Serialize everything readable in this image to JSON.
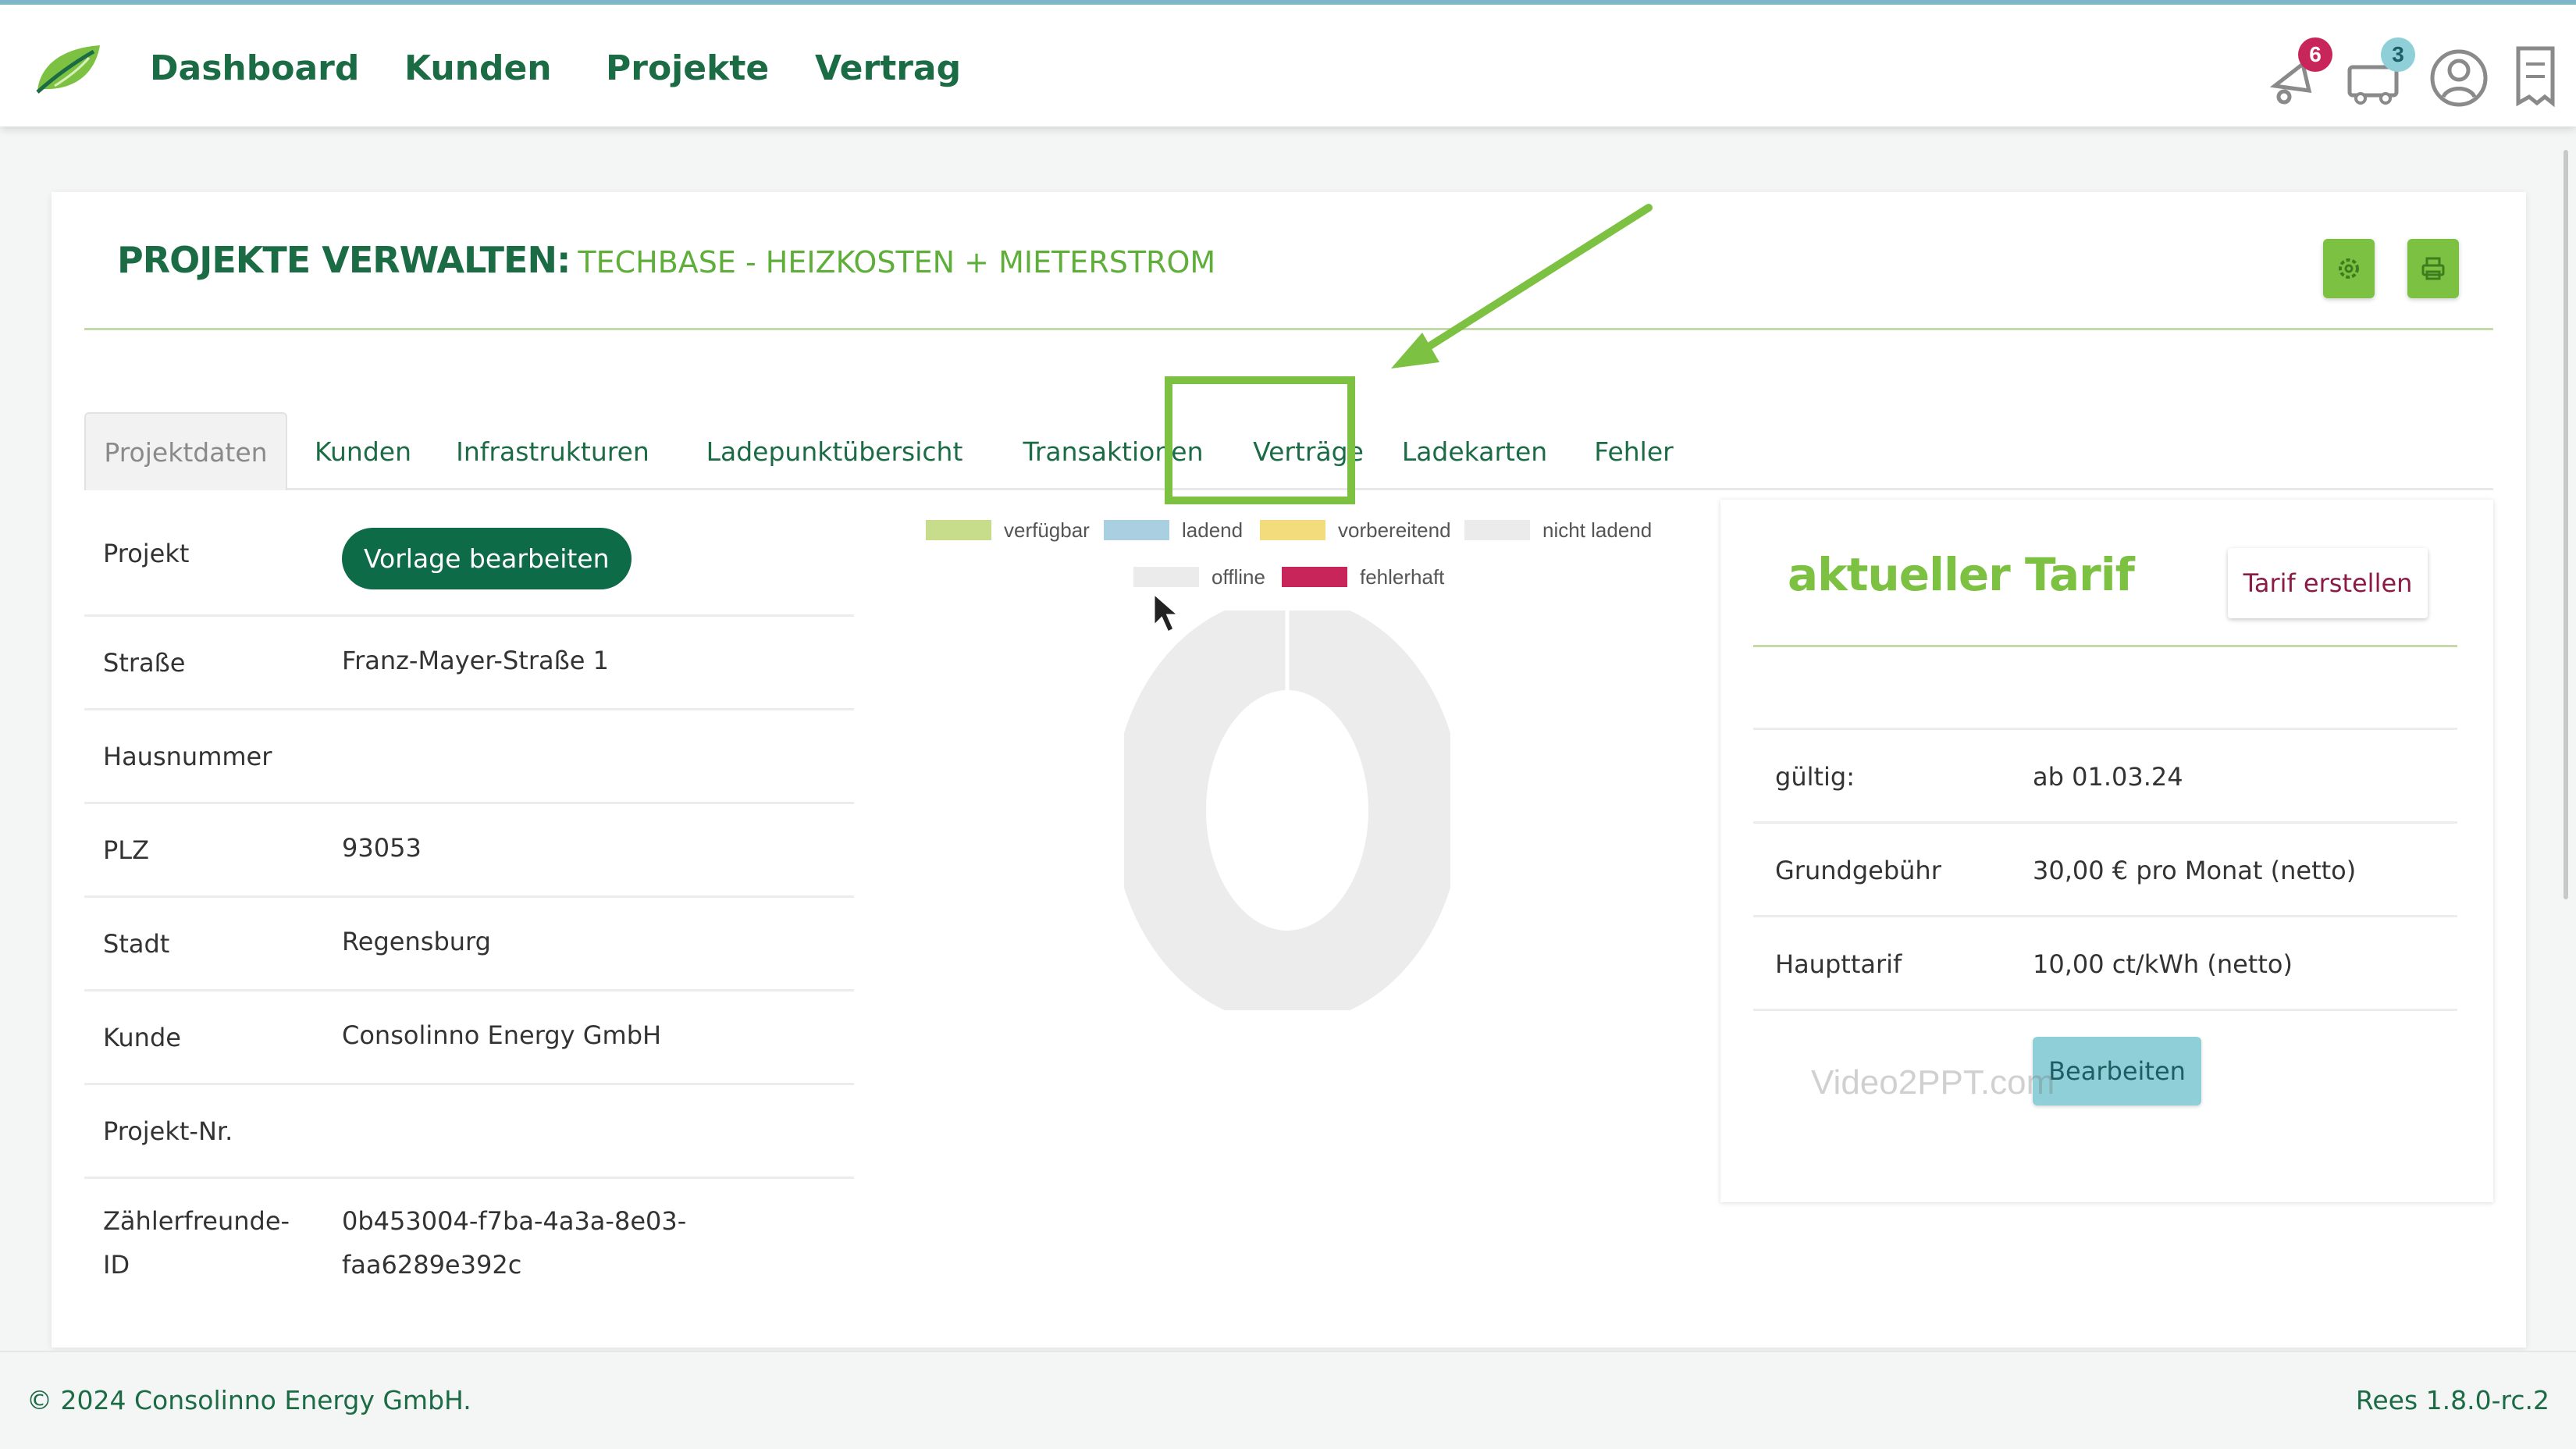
{
  "nav": {
    "items": [
      "Dashboard",
      "Kunden",
      "Projekte",
      "Vertrag"
    ],
    "notifications_count": "6",
    "messages_count": "3",
    "icons": [
      "leaf-logo",
      "bell-icon",
      "truck-icon",
      "user-icon",
      "receipt-icon"
    ]
  },
  "page": {
    "title_strong": "PROJEKTE VERWALTEN:",
    "title_sub": "TECHBASE - HEIZKOSTEN + MIETERSTROM"
  },
  "tabs": [
    "Projektdaten",
    "Kunden",
    "Infrastrukturen",
    "Ladepunktübersicht",
    "Transaktionen",
    "Verträge",
    "Ladekarten",
    "Fehler"
  ],
  "active_tab": "Projektdaten",
  "project": {
    "template_button": "Vorlage bearbeiten",
    "rows": [
      {
        "label": "Projekt",
        "value": ""
      },
      {
        "label": "Straße",
        "value": "Franz-Mayer-Straße 1"
      },
      {
        "label": "Hausnummer",
        "value": ""
      },
      {
        "label": "PLZ",
        "value": "93053"
      },
      {
        "label": "Stadt",
        "value": "Regensburg"
      },
      {
        "label": "Kunde",
        "value": "Consolinno Energy GmbH"
      },
      {
        "label": "Projekt-Nr.",
        "value": ""
      },
      {
        "label": "Zählerfreunde-",
        "label2": "ID",
        "value": "0b453004-f7ba-4a3a-8e03-",
        "value2": "faa6289e392c"
      }
    ]
  },
  "chart": {
    "legend": [
      {
        "label": "verfügbar",
        "color": "#c7dd8b"
      },
      {
        "label": "ladend",
        "color": "#a9cfe0"
      },
      {
        "label": "vorbereitend",
        "color": "#f2dc7b"
      },
      {
        "label": "nicht ladend",
        "color": "#ebebeb"
      },
      {
        "label": "offline",
        "color": "#ebebeb"
      },
      {
        "label": "fehlerhaft",
        "color": "#c8265a"
      }
    ]
  },
  "tarif": {
    "title": "aktueller Tarif",
    "create_button": "Tarif erstellen",
    "rows": [
      {
        "label": "gültig:",
        "value": "ab 01.03.24"
      },
      {
        "label": "Grundgebühr",
        "value": "30,00 € pro Monat (netto)"
      },
      {
        "label": "Haupttarif",
        "value": "10,00 ct/kWh (netto)"
      }
    ],
    "edit_button": "Bearbeiten",
    "watermark": "Video2PPT.com"
  },
  "footer": {
    "copyright": "© 2024 Consolinno Energy GmbH.",
    "version": "Rees 1.8.0-rc.2"
  }
}
